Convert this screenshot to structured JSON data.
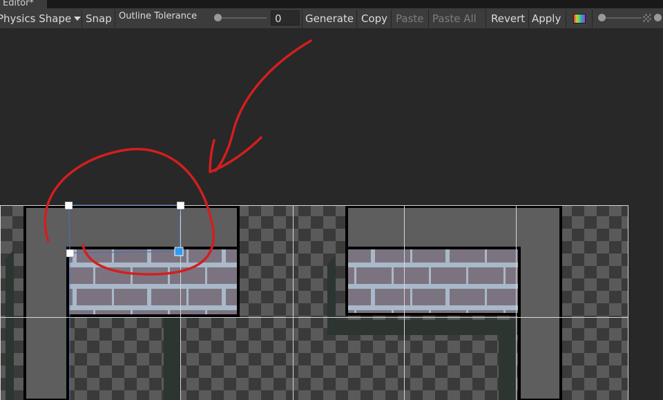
{
  "window": {
    "tab_title": "Editor*"
  },
  "toolbar": {
    "mode_label": "Physics Shape",
    "snap_label": "Snap",
    "outline_tolerance_label": "Outline Tolerance",
    "outline_tolerance_value": "0",
    "outline_tolerance_fraction": 0,
    "generate_label": "Generate",
    "copy_label": "Copy",
    "paste_label": "Paste",
    "paste_all_label": "Paste All",
    "revert_label": "Revert",
    "apply_label": "Apply",
    "zoom_fraction": 0
  },
  "colors": {
    "annotation_red": "#d41e1e",
    "selection_blue": "#2d9bf0",
    "checker_light": "#5a5a5a",
    "checker_dark": "#3a3a3a",
    "brick": "#7b7480",
    "mortar": "#a9b9c9",
    "border_black": "#000000"
  }
}
